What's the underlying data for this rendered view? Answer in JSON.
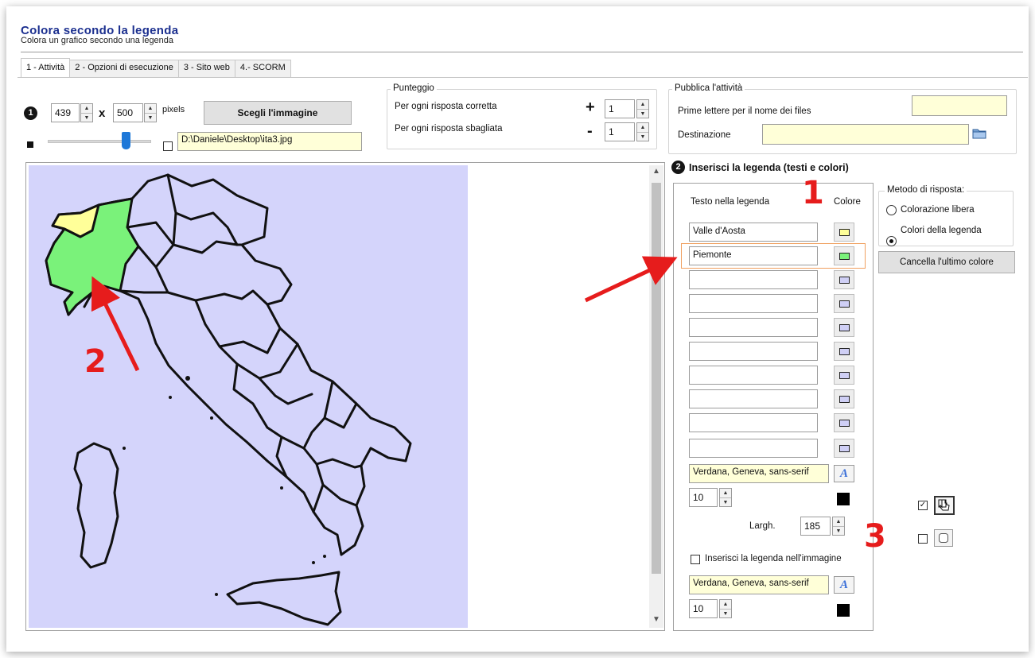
{
  "header": {
    "title": "Colora secondo la legenda",
    "subtitle": "Colora un grafico secondo una legenda"
  },
  "tabs": [
    {
      "label": "1 - Attività",
      "active": true
    },
    {
      "label": "2 - Opzioni di esecuzione",
      "active": false
    },
    {
      "label": "3 - Sito web",
      "active": false
    },
    {
      "label": "4.- SCORM",
      "active": false
    }
  ],
  "image_section": {
    "step_number": "1",
    "width_value": "439",
    "times_sign": "x",
    "height_value": "500",
    "pixels_label": "pixels",
    "choose_image_label": "Scegli l'immagine",
    "zoom_level_fraction": 0.75,
    "image_path": "D:\\Daniele\\Desktop\\ita3.jpg"
  },
  "score": {
    "group_label": "Punteggio",
    "correct_label": "Per ogni risposta corretta",
    "correct_sign": "+",
    "correct_value": "1",
    "wrong_label": "Per ogni risposta sbagliata",
    "wrong_sign": "-",
    "wrong_value": "1"
  },
  "publish": {
    "group_label": "Pubblica l'attività",
    "prefix_label": "Prime lettere per il nome dei files",
    "prefix_value": "",
    "destination_label": "Destinazione",
    "destination_value": ""
  },
  "map": {
    "background_color": "#d4d4fb",
    "highlight_green": "#7af27a",
    "highlight_yellow": "#ffff99"
  },
  "legend": {
    "step_number": "2",
    "section_title": "Inserisci la legenda (testi e colori)",
    "text_column_label": "Testo nella legenda",
    "color_column_label": "Colore",
    "rows": [
      {
        "text": "Valle d'Aosta",
        "color": "#ffff99"
      },
      {
        "text": "Piemonte",
        "color": "#7af27a"
      },
      {
        "text": "",
        "color": "#cfcff5"
      },
      {
        "text": "",
        "color": "#cfcff5"
      },
      {
        "text": "",
        "color": "#cfcff5"
      },
      {
        "text": "",
        "color": "#cfcff5"
      },
      {
        "text": "",
        "color": "#cfcff5"
      },
      {
        "text": "",
        "color": "#cfcff5"
      },
      {
        "text": "",
        "color": "#cfcff5"
      },
      {
        "text": "",
        "color": "#cfcff5"
      }
    ],
    "font_value": "Verdana, Geneva, sans-serif",
    "font_size_value": "10",
    "width_label": "Largh.",
    "width_value": "185",
    "insert_in_image_label": "Inserisci la legenda nell'immagine",
    "image_font_value": "Verdana, Geneva, sans-serif",
    "image_font_size_value": "10",
    "font_color": "#000000"
  },
  "response_method": {
    "group_label": "Metodo di risposta:",
    "option_free": "Colorazione libera",
    "option_legend": "Colori della legenda",
    "selected": "Colori della legenda",
    "clear_last_color_label": "Cancella l'ultimo colore"
  },
  "tools": {
    "pointer_checked": true,
    "shape_checked": false
  },
  "annotations": {
    "label_1": "1",
    "label_2": "2",
    "label_3": "3",
    "color": "#e61c1c"
  }
}
